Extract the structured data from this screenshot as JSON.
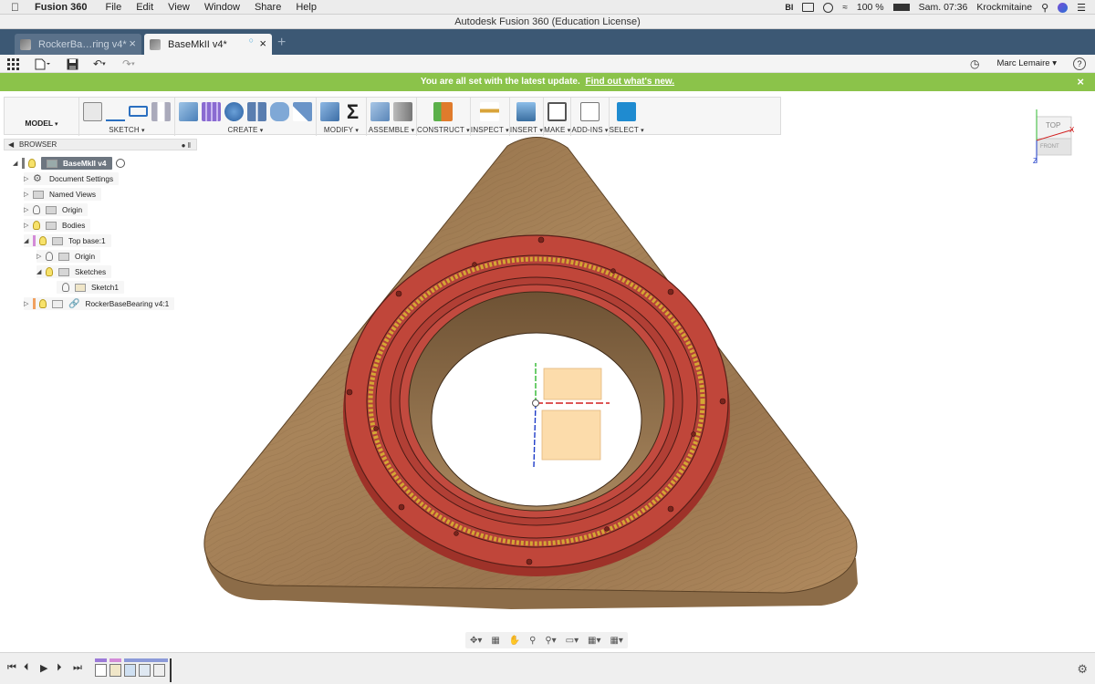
{
  "menubar": {
    "app_name": "Fusion 360",
    "items": [
      "File",
      "Edit",
      "View",
      "Window",
      "Share",
      "Help"
    ],
    "battery": "100 %",
    "clock": "Sam. 07:36",
    "user": "Krockmitaine"
  },
  "window_title": "Autodesk Fusion 360 (Education License)",
  "tabs": [
    {
      "label": "RockerBa…ring v4*",
      "active": false
    },
    {
      "label": "BaseMkII v4*",
      "active": true
    }
  ],
  "qab": {
    "user_name": "Marc Lemaire",
    "help": "?"
  },
  "banner": {
    "text": "You are all set with the latest update.",
    "link": "Find out what's new."
  },
  "toolbar": {
    "workspace": "MODEL",
    "groups": [
      {
        "label": "SKETCH"
      },
      {
        "label": "CREATE"
      },
      {
        "label": "MODIFY"
      },
      {
        "label": "ASSEMBLE"
      },
      {
        "label": "CONSTRUCT"
      },
      {
        "label": "INSPECT"
      },
      {
        "label": "INSERT"
      },
      {
        "label": "MAKE"
      },
      {
        "label": "ADD-INS"
      },
      {
        "label": "SELECT"
      }
    ]
  },
  "browser": {
    "title": "BROWSER",
    "items": [
      {
        "label": "BaseMkII v4"
      },
      {
        "label": "Document Settings"
      },
      {
        "label": "Named Views"
      },
      {
        "label": "Origin"
      },
      {
        "label": "Bodies"
      },
      {
        "label": "Top base:1"
      },
      {
        "label": "Origin"
      },
      {
        "label": "Sketches"
      },
      {
        "label": "Sketch1"
      },
      {
        "label": "RockerBaseBearing v4:1"
      }
    ]
  },
  "viewcube": {
    "top": "TOP",
    "front": "FRONT",
    "x": "X",
    "z": "Z"
  },
  "colors": {
    "tab_strip": "#3c5874",
    "banner": "#8bc34a",
    "wood": "#a07a4e",
    "bearing": "#c0463a",
    "select_active": "#1f8bd0"
  }
}
